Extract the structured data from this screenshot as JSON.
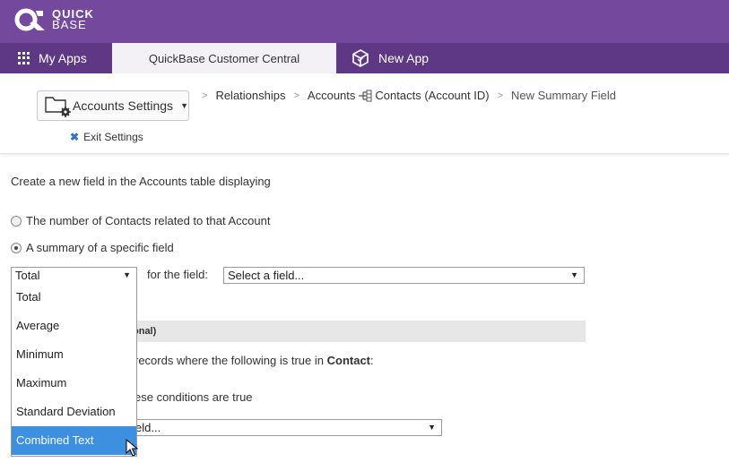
{
  "brand": {
    "line1": "QUICK",
    "line2": "BASE"
  },
  "tabs": {
    "my_apps": "My Apps",
    "active": "QuickBase Customer Central",
    "new_app": "New App"
  },
  "settings": {
    "button_label": "Accounts Settings",
    "exit_label": "Exit Settings"
  },
  "breadcrumb": {
    "relationships": "Relationships",
    "accounts": "Accounts",
    "contacts": "Contacts (Account ID)",
    "current": "New Summary Field"
  },
  "form": {
    "intro": "Create a new field in the Accounts table displaying",
    "radio_count_label": "The number of Contacts related to that Account",
    "radio_summary_label": "A summary of a specific field",
    "radio_summary_checked": true,
    "summary_type_value": "Total",
    "for_field_label": "for the field:",
    "field_select_value": "Select a field...",
    "filter_header_visible": "onal)",
    "filter_text_prefix": "records where the following is true in ",
    "filter_text_table": "Contact",
    "filter_text_suffix": ":",
    "conditions_text": "ese conditions are true",
    "condition_field_value": "eld..."
  },
  "summary_options": [
    "Total",
    "Average",
    "Minimum",
    "Maximum",
    "Standard Deviation",
    "Combined Text"
  ],
  "summary_highlighted": "Combined Text",
  "colors": {
    "brand_purple": "#74489d",
    "tab_purple": "#5e3885",
    "highlight_blue": "#3d8fe0"
  },
  "icons": {
    "apps": "grid-icon",
    "new_app": "cube-icon",
    "settings": "folder-gear-icon",
    "exit": "close-icon",
    "relationship": "relationship-icon"
  }
}
